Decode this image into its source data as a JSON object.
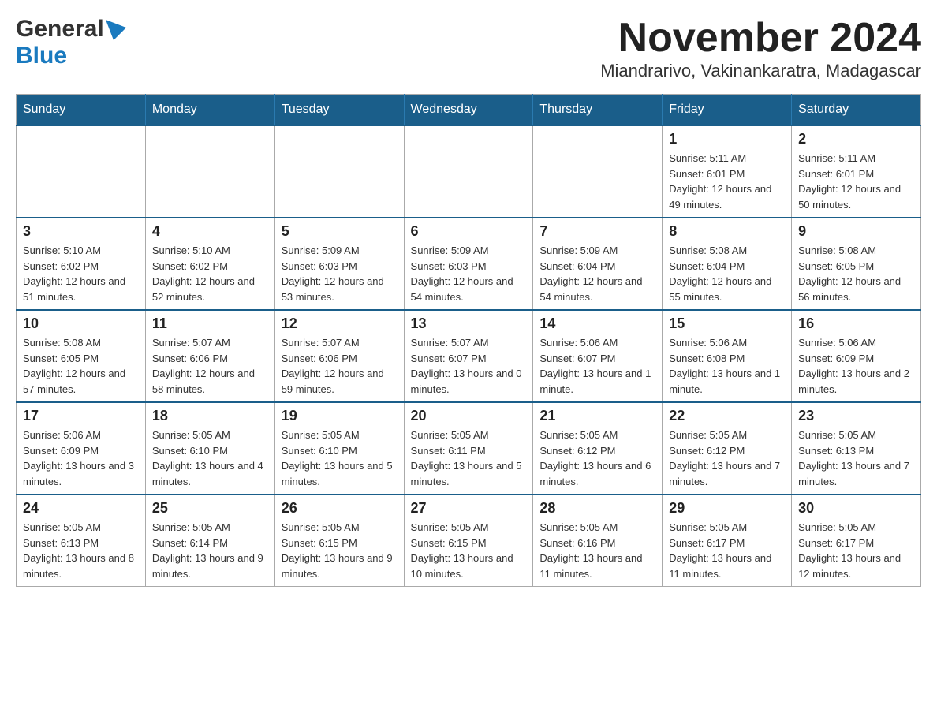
{
  "header": {
    "logo_general": "General",
    "logo_blue": "Blue",
    "title": "November 2024",
    "subtitle": "Miandrarivo, Vakinankaratra, Madagascar"
  },
  "days_of_week": [
    "Sunday",
    "Monday",
    "Tuesday",
    "Wednesday",
    "Thursday",
    "Friday",
    "Saturday"
  ],
  "weeks": [
    [
      {
        "day": "",
        "info": ""
      },
      {
        "day": "",
        "info": ""
      },
      {
        "day": "",
        "info": ""
      },
      {
        "day": "",
        "info": ""
      },
      {
        "day": "",
        "info": ""
      },
      {
        "day": "1",
        "info": "Sunrise: 5:11 AM\nSunset: 6:01 PM\nDaylight: 12 hours and 49 minutes."
      },
      {
        "day": "2",
        "info": "Sunrise: 5:11 AM\nSunset: 6:01 PM\nDaylight: 12 hours and 50 minutes."
      }
    ],
    [
      {
        "day": "3",
        "info": "Sunrise: 5:10 AM\nSunset: 6:02 PM\nDaylight: 12 hours and 51 minutes."
      },
      {
        "day": "4",
        "info": "Sunrise: 5:10 AM\nSunset: 6:02 PM\nDaylight: 12 hours and 52 minutes."
      },
      {
        "day": "5",
        "info": "Sunrise: 5:09 AM\nSunset: 6:03 PM\nDaylight: 12 hours and 53 minutes."
      },
      {
        "day": "6",
        "info": "Sunrise: 5:09 AM\nSunset: 6:03 PM\nDaylight: 12 hours and 54 minutes."
      },
      {
        "day": "7",
        "info": "Sunrise: 5:09 AM\nSunset: 6:04 PM\nDaylight: 12 hours and 54 minutes."
      },
      {
        "day": "8",
        "info": "Sunrise: 5:08 AM\nSunset: 6:04 PM\nDaylight: 12 hours and 55 minutes."
      },
      {
        "day": "9",
        "info": "Sunrise: 5:08 AM\nSunset: 6:05 PM\nDaylight: 12 hours and 56 minutes."
      }
    ],
    [
      {
        "day": "10",
        "info": "Sunrise: 5:08 AM\nSunset: 6:05 PM\nDaylight: 12 hours and 57 minutes."
      },
      {
        "day": "11",
        "info": "Sunrise: 5:07 AM\nSunset: 6:06 PM\nDaylight: 12 hours and 58 minutes."
      },
      {
        "day": "12",
        "info": "Sunrise: 5:07 AM\nSunset: 6:06 PM\nDaylight: 12 hours and 59 minutes."
      },
      {
        "day": "13",
        "info": "Sunrise: 5:07 AM\nSunset: 6:07 PM\nDaylight: 13 hours and 0 minutes."
      },
      {
        "day": "14",
        "info": "Sunrise: 5:06 AM\nSunset: 6:07 PM\nDaylight: 13 hours and 1 minute."
      },
      {
        "day": "15",
        "info": "Sunrise: 5:06 AM\nSunset: 6:08 PM\nDaylight: 13 hours and 1 minute."
      },
      {
        "day": "16",
        "info": "Sunrise: 5:06 AM\nSunset: 6:09 PM\nDaylight: 13 hours and 2 minutes."
      }
    ],
    [
      {
        "day": "17",
        "info": "Sunrise: 5:06 AM\nSunset: 6:09 PM\nDaylight: 13 hours and 3 minutes."
      },
      {
        "day": "18",
        "info": "Sunrise: 5:05 AM\nSunset: 6:10 PM\nDaylight: 13 hours and 4 minutes."
      },
      {
        "day": "19",
        "info": "Sunrise: 5:05 AM\nSunset: 6:10 PM\nDaylight: 13 hours and 5 minutes."
      },
      {
        "day": "20",
        "info": "Sunrise: 5:05 AM\nSunset: 6:11 PM\nDaylight: 13 hours and 5 minutes."
      },
      {
        "day": "21",
        "info": "Sunrise: 5:05 AM\nSunset: 6:12 PM\nDaylight: 13 hours and 6 minutes."
      },
      {
        "day": "22",
        "info": "Sunrise: 5:05 AM\nSunset: 6:12 PM\nDaylight: 13 hours and 7 minutes."
      },
      {
        "day": "23",
        "info": "Sunrise: 5:05 AM\nSunset: 6:13 PM\nDaylight: 13 hours and 7 minutes."
      }
    ],
    [
      {
        "day": "24",
        "info": "Sunrise: 5:05 AM\nSunset: 6:13 PM\nDaylight: 13 hours and 8 minutes."
      },
      {
        "day": "25",
        "info": "Sunrise: 5:05 AM\nSunset: 6:14 PM\nDaylight: 13 hours and 9 minutes."
      },
      {
        "day": "26",
        "info": "Sunrise: 5:05 AM\nSunset: 6:15 PM\nDaylight: 13 hours and 9 minutes."
      },
      {
        "day": "27",
        "info": "Sunrise: 5:05 AM\nSunset: 6:15 PM\nDaylight: 13 hours and 10 minutes."
      },
      {
        "day": "28",
        "info": "Sunrise: 5:05 AM\nSunset: 6:16 PM\nDaylight: 13 hours and 11 minutes."
      },
      {
        "day": "29",
        "info": "Sunrise: 5:05 AM\nSunset: 6:17 PM\nDaylight: 13 hours and 11 minutes."
      },
      {
        "day": "30",
        "info": "Sunrise: 5:05 AM\nSunset: 6:17 PM\nDaylight: 13 hours and 12 minutes."
      }
    ]
  ]
}
